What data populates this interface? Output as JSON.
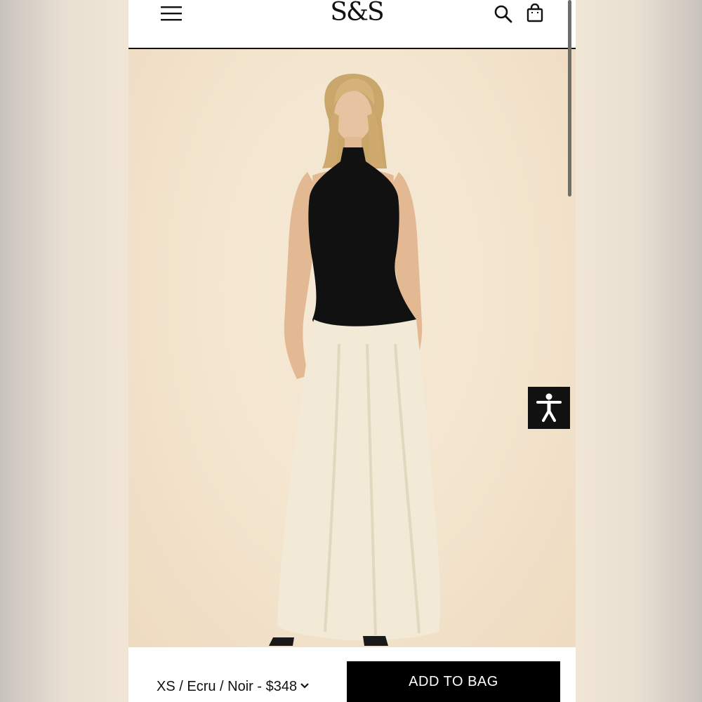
{
  "header": {
    "logo": "S&S",
    "menu_icon": "hamburger-menu-icon",
    "search_icon": "search-icon",
    "bag_icon": "shopping-bag-icon"
  },
  "hero": {
    "image": "product-photo",
    "background_color": "#f3e4cd"
  },
  "accessibility": {
    "icon": "accessibility-person-icon"
  },
  "purchase": {
    "variant_label": "XS / Ecru / Noir - $348",
    "chevron_icon": "chevron-down-icon",
    "add_to_bag_label": "ADD TO BAG"
  },
  "colors": {
    "accent": "#000000",
    "top": "#111111",
    "skirt": "#f2ead6"
  }
}
